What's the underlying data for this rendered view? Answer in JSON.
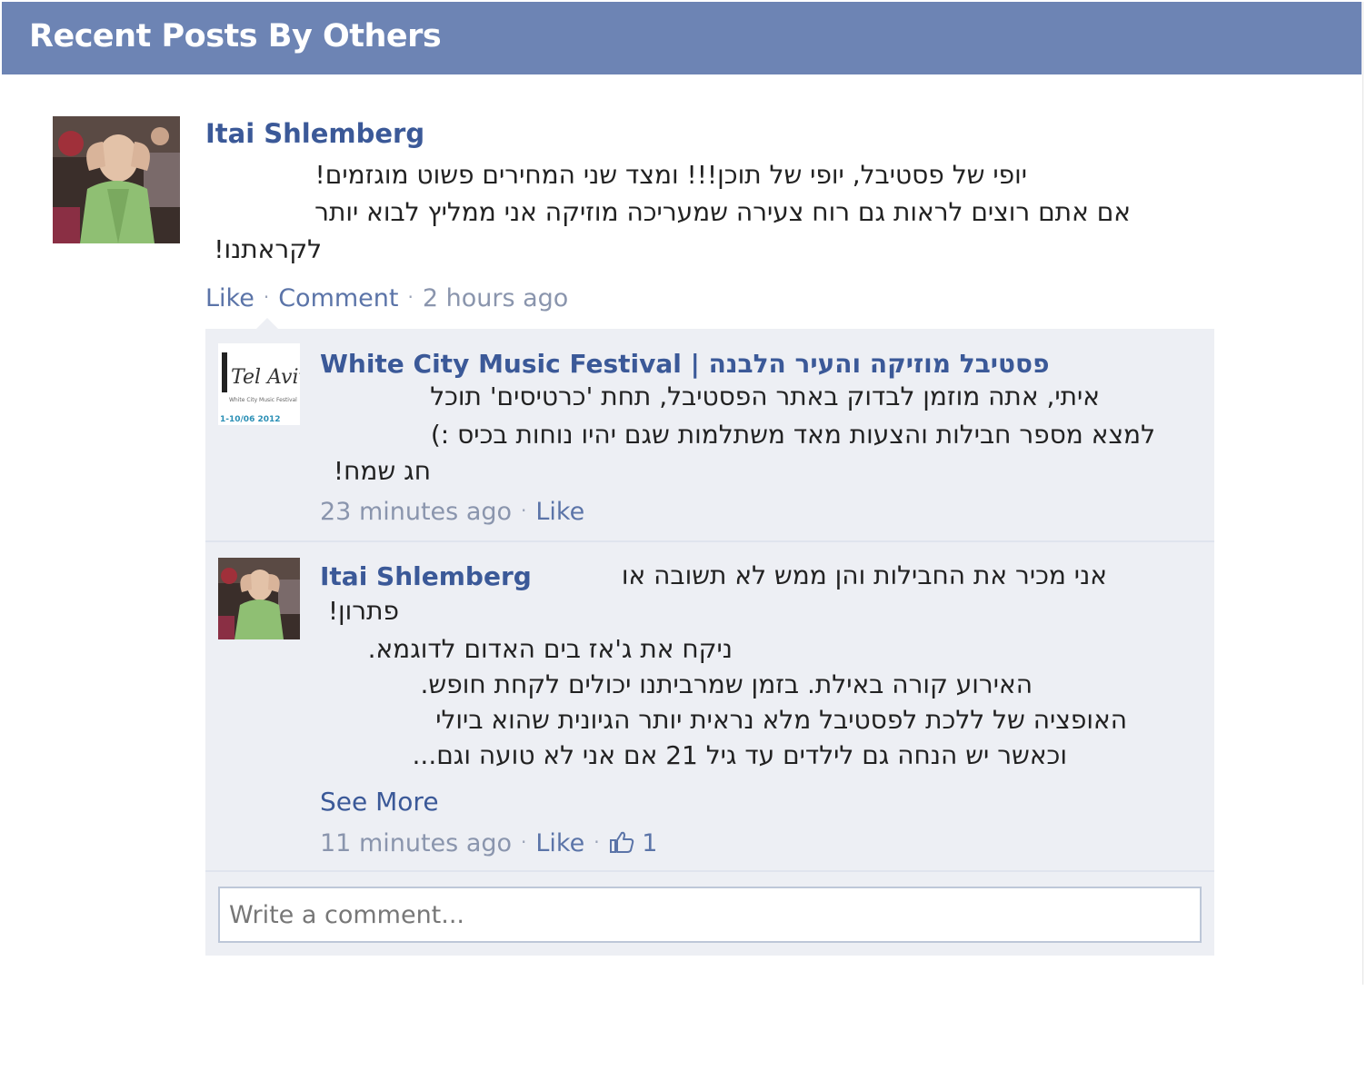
{
  "header": {
    "title": "Recent Posts By Others"
  },
  "post": {
    "author": "Itai Shlemberg",
    "text_lines": [
      "יופי של פסטיבל, יופי של תוכן!!! ומצד שני המחירים פשוט מוגזמים!",
      "אם אתם רוצים לראות גם רוח צעירה שמעריכה מוזיקה אני ממליץ לבוא יותר",
      "לקראתנו!"
    ],
    "actions": {
      "like": "Like",
      "comment": "Comment",
      "time": "2 hours ago"
    }
  },
  "comments": [
    {
      "author": "White City Music Festival | פסטיבל מוזיקה והעיר הלבנה",
      "avatar_logo": {
        "line1": "Tel Aviv",
        "line2": "White City Music Festival",
        "dates": "1-10/06 2012"
      },
      "text_lines": [
        "איתי, אתה מוזמן לבדוק באתר הפסטיבל, תחת 'כרטיסים' תוכל",
        "למצא מספר חבילות והצעות מאד משתלמות שגם יהיו נוחות בכיס :)",
        "חג שמח!"
      ],
      "time": "23 minutes ago",
      "like": "Like"
    },
    {
      "author": "Itai Shlemberg",
      "first_line": "אני מכיר את החבילות והן ממש לא תשובה או",
      "text_lines": [
        "פתרון!",
        "ניקח את ג'אז בים האדום לדוגמא.",
        "האירוע קורה באילת. בזמן שמרביתנו יכולים לקחת חופש.",
        "האופציה של ללכת לפסטיבל מלא נראית יותר הגיונית שהוא ביולי",
        "וכאשר יש הנחה גם לילדים עד גיל 21 אם אני לא טועה וגם..."
      ],
      "see_more": "See More",
      "time": "11 minutes ago",
      "like": "Like",
      "like_icon": "thumbs-up-icon",
      "like_count": "1"
    }
  ],
  "comment_input": {
    "placeholder": "Write a comment..."
  },
  "colors": {
    "header_bg": "#6d84b4",
    "link": "#3b5998",
    "comments_bg": "#edeff4"
  }
}
